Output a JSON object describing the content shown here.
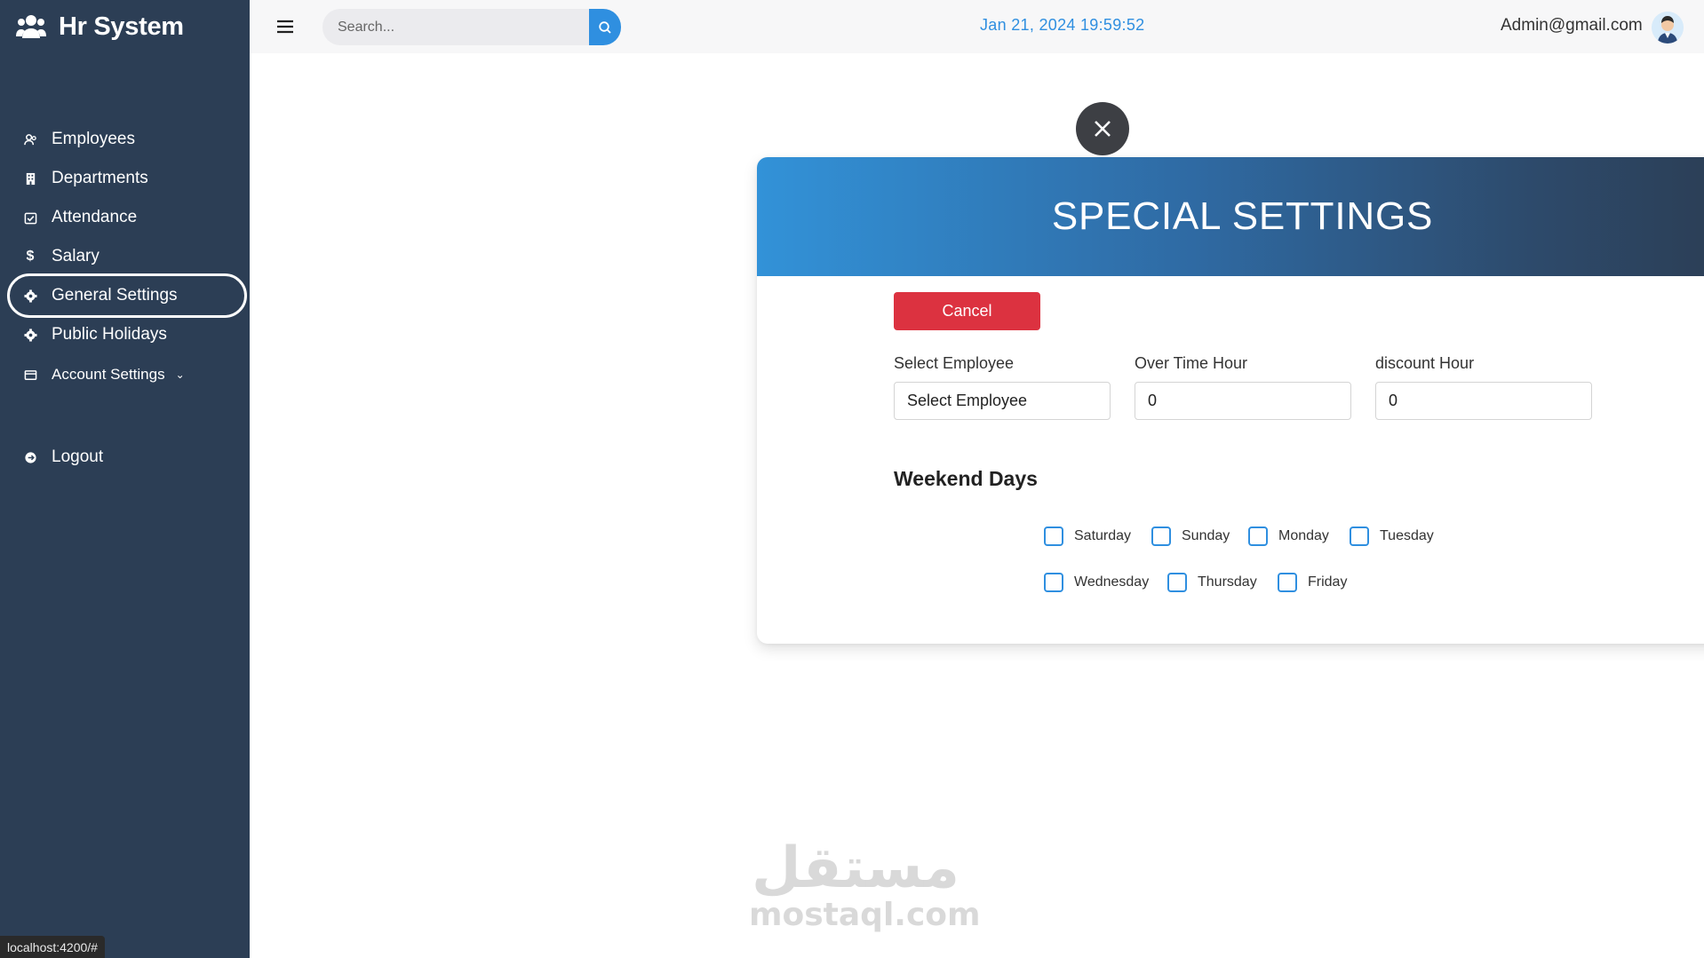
{
  "app": {
    "title": "Hr System"
  },
  "sidebar": {
    "items": [
      {
        "label": "Employees",
        "icon": "users-icon"
      },
      {
        "label": "Departments",
        "icon": "building-icon"
      },
      {
        "label": "Attendance",
        "icon": "calendar-check-icon"
      },
      {
        "label": "Salary",
        "icon": "dollar-icon"
      },
      {
        "label": "General Settings",
        "icon": "gear-icon",
        "active": true
      },
      {
        "label": "Public Holidays",
        "icon": "gear-icon"
      },
      {
        "label": "Account Settings",
        "icon": "id-card-icon",
        "has_dropdown": true
      },
      {
        "label": "Logout",
        "icon": "logout-icon"
      }
    ]
  },
  "topbar": {
    "search_placeholder": "Search...",
    "datetime": "Jan 21, 2024 19:59:52",
    "user_email": "Admin@gmail.com"
  },
  "modal": {
    "title": "SPECIAL SETTINGS",
    "cancel_label": "Cancel",
    "fields": {
      "employee": {
        "label": "Select Employee",
        "value": "Select Employee"
      },
      "overtime": {
        "label": "Over Time Hour",
        "value": "0"
      },
      "discount": {
        "label": "discount Hour",
        "value": "0"
      }
    },
    "weekend_title": "Weekend Days",
    "days": [
      "Saturday",
      "Sunday",
      "Monday",
      "Tuesday",
      "Wednesday",
      "Thursday",
      "Friday"
    ]
  },
  "statusbar": {
    "url": "localhost:4200/#"
  },
  "watermark": {
    "arabic": "مستقل",
    "latin": "mostaql.com"
  },
  "colors": {
    "sidebar_bg": "#2c3e55",
    "accent": "#2f8fe0",
    "danger": "#dc3240"
  }
}
